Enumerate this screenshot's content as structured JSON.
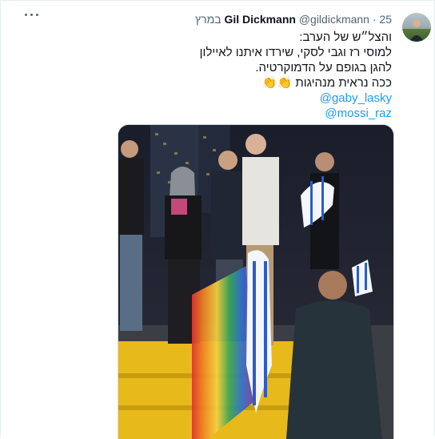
{
  "tweet": {
    "author_name": "Gil Dickmann",
    "handle": "@gildickmann",
    "separator": "·",
    "date": "25 במרץ",
    "lines": [
      "והצל״ש של הערב:",
      "למוסי רז וגבי לסקי, שירדו איתנו לאיילון",
      "להגן בגופם על הדמוקרטיה.",
      "ככה נראית מנהיגות 👏👏"
    ],
    "mentions": [
      "@gaby_lasky",
      "@mossi_raz"
    ]
  },
  "icons": {
    "more": "more-horizontal-icon",
    "avatar": "avatar"
  },
  "colors": {
    "link": "#1d9bf0",
    "text": "#0f1419",
    "muted": "#536471"
  }
}
